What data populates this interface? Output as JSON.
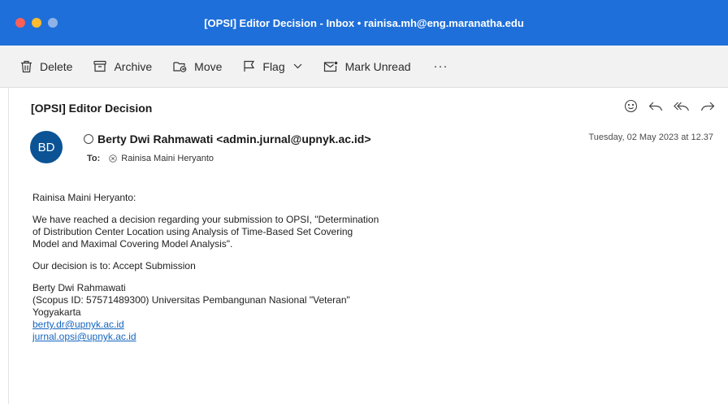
{
  "window": {
    "title": "[OPSI] Editor Decision - Inbox • rainisa.mh@eng.maranatha.edu"
  },
  "toolbar": {
    "delete": "Delete",
    "archive": "Archive",
    "move": "Move",
    "flag": "Flag",
    "mark_unread": "Mark Unread",
    "more": "···"
  },
  "message": {
    "subject": "[OPSI] Editor Decision",
    "avatar_initials": "BD",
    "sender": "Berty Dwi Rahmawati <admin.jurnal@upnyk.ac.id>",
    "to_label": "To:",
    "recipient": "Rainisa Maini Heryanto",
    "date": "Tuesday, 02 May 2023 at 12.37",
    "greeting": "Rainisa Maini Heryanto:",
    "para1_lines": [
      "We have reached a decision regarding your submission to OPSI, \"Determination",
      "of Distribution Center Location using Analysis of Time-Based Set Covering",
      "Model and Maximal Covering Model Analysis\"."
    ],
    "decision": "Our decision is to: Accept Submission",
    "signature": [
      "Berty Dwi Rahmawati",
      "(Scopus ID: 57571489300) Universitas Pembangunan Nasional \"Veteran\"",
      "Yogyakarta"
    ],
    "links": [
      "berty.dr@upnyk.ac.id",
      "jurnal.opsi@upnyk.ac.id"
    ]
  },
  "colors": {
    "titlebar": "#1e6fd9",
    "avatar": "#0b5394",
    "link": "#1565c0"
  }
}
